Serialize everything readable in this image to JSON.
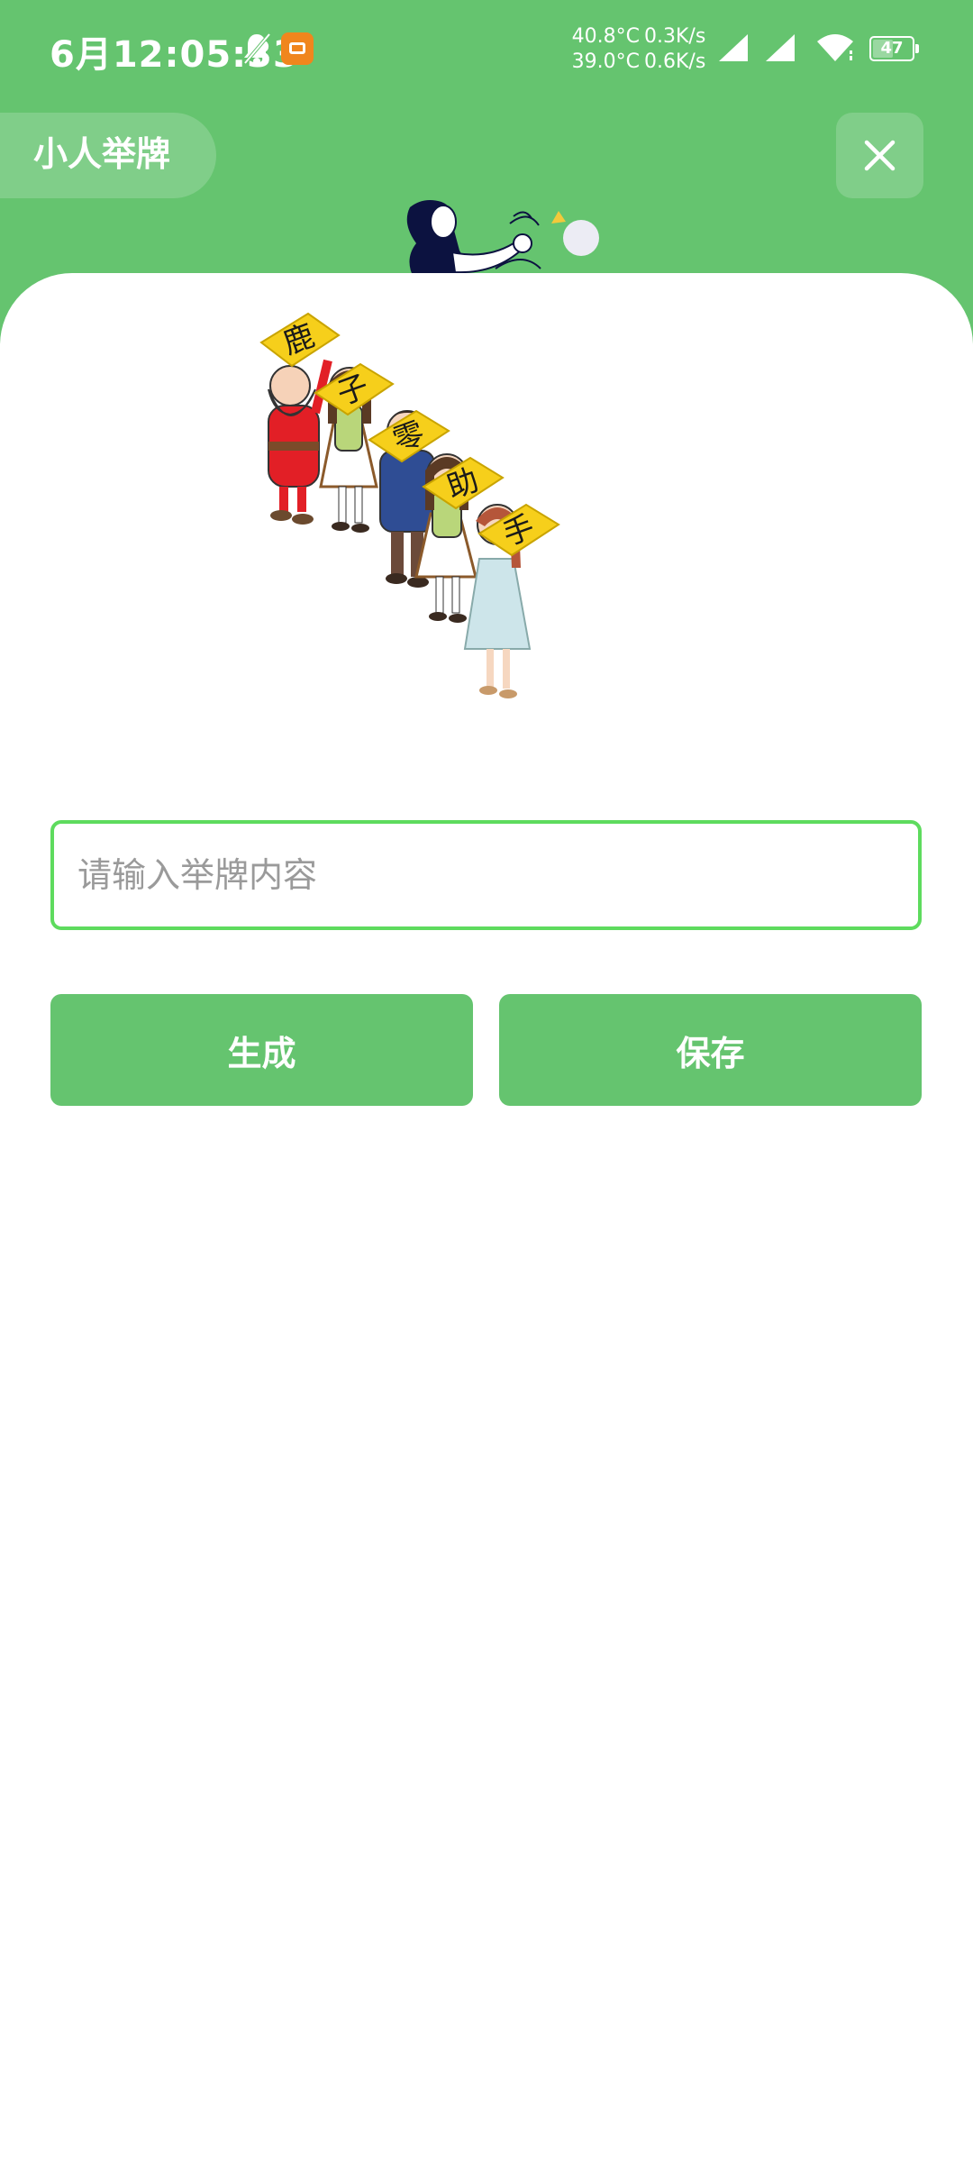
{
  "status_bar": {
    "time": "6月12:05:33",
    "temp_1": "40.8°C",
    "temp_2": "39.0°C",
    "speed_up": "0.3K/s",
    "speed_down": "0.6K/s",
    "battery": "47"
  },
  "header": {
    "title": "小人举牌",
    "close_icon": "close-icon"
  },
  "illustration": {
    "sign_chars": [
      "鹿",
      "子",
      "零",
      "助",
      "手"
    ]
  },
  "form": {
    "input_value": "",
    "input_placeholder": "请输入举牌内容"
  },
  "buttons": {
    "generate_label": "生成",
    "save_label": "保存"
  },
  "colors": {
    "brand_green": "#65C46F",
    "input_border": "#5EDB5E",
    "sign_yellow": "#F6CF1B"
  }
}
